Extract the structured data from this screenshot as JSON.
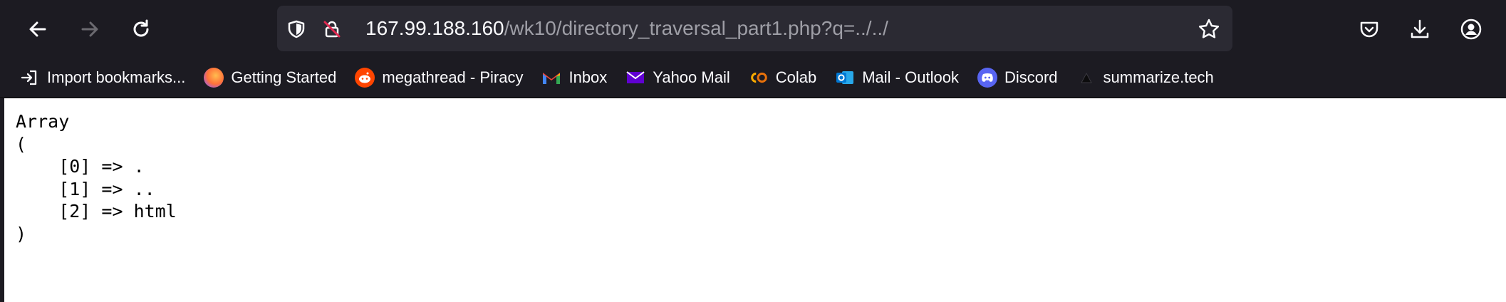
{
  "browser": {
    "url": {
      "host": "167.99.188.160",
      "path": "/wk10/directory_traversal_part1.php?q=../../"
    },
    "bookmarks": [
      {
        "label": "Import bookmarks...",
        "icon": "import-icon"
      },
      {
        "label": "Getting Started",
        "icon": "firefox-icon"
      },
      {
        "label": "megathread - Piracy",
        "icon": "reddit-icon"
      },
      {
        "label": "Inbox",
        "icon": "gmail-icon"
      },
      {
        "label": "Yahoo Mail",
        "icon": "yahoo-mail-icon"
      },
      {
        "label": "Colab",
        "icon": "colab-icon"
      },
      {
        "label": "Mail - Outlook",
        "icon": "outlook-icon"
      },
      {
        "label": "Discord",
        "icon": "discord-icon"
      },
      {
        "label": "summarize.tech",
        "icon": "summarize-icon"
      }
    ]
  },
  "page": {
    "lines": [
      "Array",
      "(",
      "    [0] => .",
      "    [1] => ..",
      "    [2] => html",
      ")"
    ]
  }
}
